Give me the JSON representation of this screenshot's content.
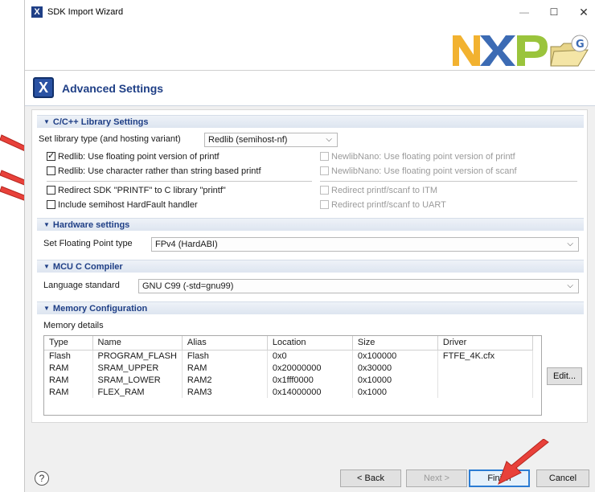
{
  "window": {
    "title": "SDK Import Wizard",
    "minimize": "—",
    "maximize": "☐",
    "close": "✕"
  },
  "colors": {
    "accent": "#1f3f86",
    "arrow": "#e8413a",
    "focus": "#2b7cd3"
  },
  "page": {
    "title": "Advanced Settings",
    "icon": "X"
  },
  "clib": {
    "header": "C/C++ Library Settings",
    "type_label": "Set library type (and hosting variant)",
    "type_value": "Redlib (semihost-nf)",
    "left": [
      {
        "label": "Redlib: Use floating point version of printf",
        "checked": true
      },
      {
        "label": "Redlib: Use character rather than string based printf",
        "checked": false
      },
      {
        "label": "Redirect SDK \"PRINTF\" to C library \"printf\"",
        "checked": false
      },
      {
        "label": "Include semihost HardFault handler",
        "checked": false
      }
    ],
    "right": [
      {
        "label": "NewlibNano: Use floating point version of printf",
        "checked": false
      },
      {
        "label": "NewlibNano: Use floating point version of scanf",
        "checked": false
      },
      {
        "label": "Redirect printf/scanf to ITM",
        "checked": false
      },
      {
        "label": "Redirect printf/scanf to UART",
        "checked": false
      }
    ]
  },
  "hardware": {
    "header": "Hardware settings",
    "fp_label": "Set Floating Point type",
    "fp_value": "FPv4 (HardABI)"
  },
  "compiler": {
    "header": "MCU C Compiler",
    "std_label": "Language standard",
    "std_value": "GNU C99 (-std=gnu99)"
  },
  "memory": {
    "header": "Memory Configuration",
    "details_label": "Memory details",
    "columns": [
      "Type",
      "Name",
      "Alias",
      "Location",
      "Size",
      "Driver"
    ],
    "rows": [
      [
        "Flash",
        "PROGRAM_FLASH",
        "Flash",
        "0x0",
        "0x100000",
        "FTFE_4K.cfx"
      ],
      [
        "RAM",
        "SRAM_UPPER",
        "RAM",
        "0x20000000",
        "0x30000",
        ""
      ],
      [
        "RAM",
        "SRAM_LOWER",
        "RAM2",
        "0x1fff0000",
        "0x10000",
        ""
      ],
      [
        "RAM",
        "FLEX_RAM",
        "RAM3",
        "0x14000000",
        "0x1000",
        ""
      ]
    ],
    "edit_label": "Edit..."
  },
  "footer": {
    "help": "?",
    "back": "< Back",
    "next": "Next >",
    "finish": "Finish",
    "cancel": "Cancel"
  }
}
